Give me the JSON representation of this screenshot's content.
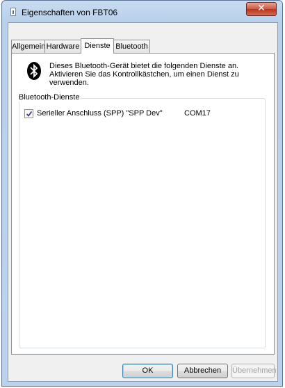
{
  "window": {
    "title": "Eigenschaften von FBT06",
    "close_glyph": "✕"
  },
  "tabs": [
    {
      "label": "Allgemein",
      "active": false
    },
    {
      "label": "Hardware",
      "active": false
    },
    {
      "label": "Dienste",
      "active": true
    },
    {
      "label": "Bluetooth",
      "active": false
    }
  ],
  "content": {
    "intro_icon": "bluetooth-icon",
    "intro_text": "Dieses Bluetooth-Gerät bietet die folgenden Dienste an. Aktivieren Sie das Kontrollkästchen, um einen Dienst zu verwenden.",
    "group_label": "Bluetooth-Dienste",
    "services": [
      {
        "name": "Serieller Anschluss (SPP) \"SPP Dev\"",
        "port": "COM17",
        "checked": true
      }
    ]
  },
  "buttons": {
    "ok": "OK",
    "cancel": "Abbrechen",
    "apply": "Übernehmen"
  },
  "colors": {
    "bluetooth_icon_bg": "#000000",
    "titlebar": "#bcd2ec",
    "close_button": "#c95a47"
  }
}
